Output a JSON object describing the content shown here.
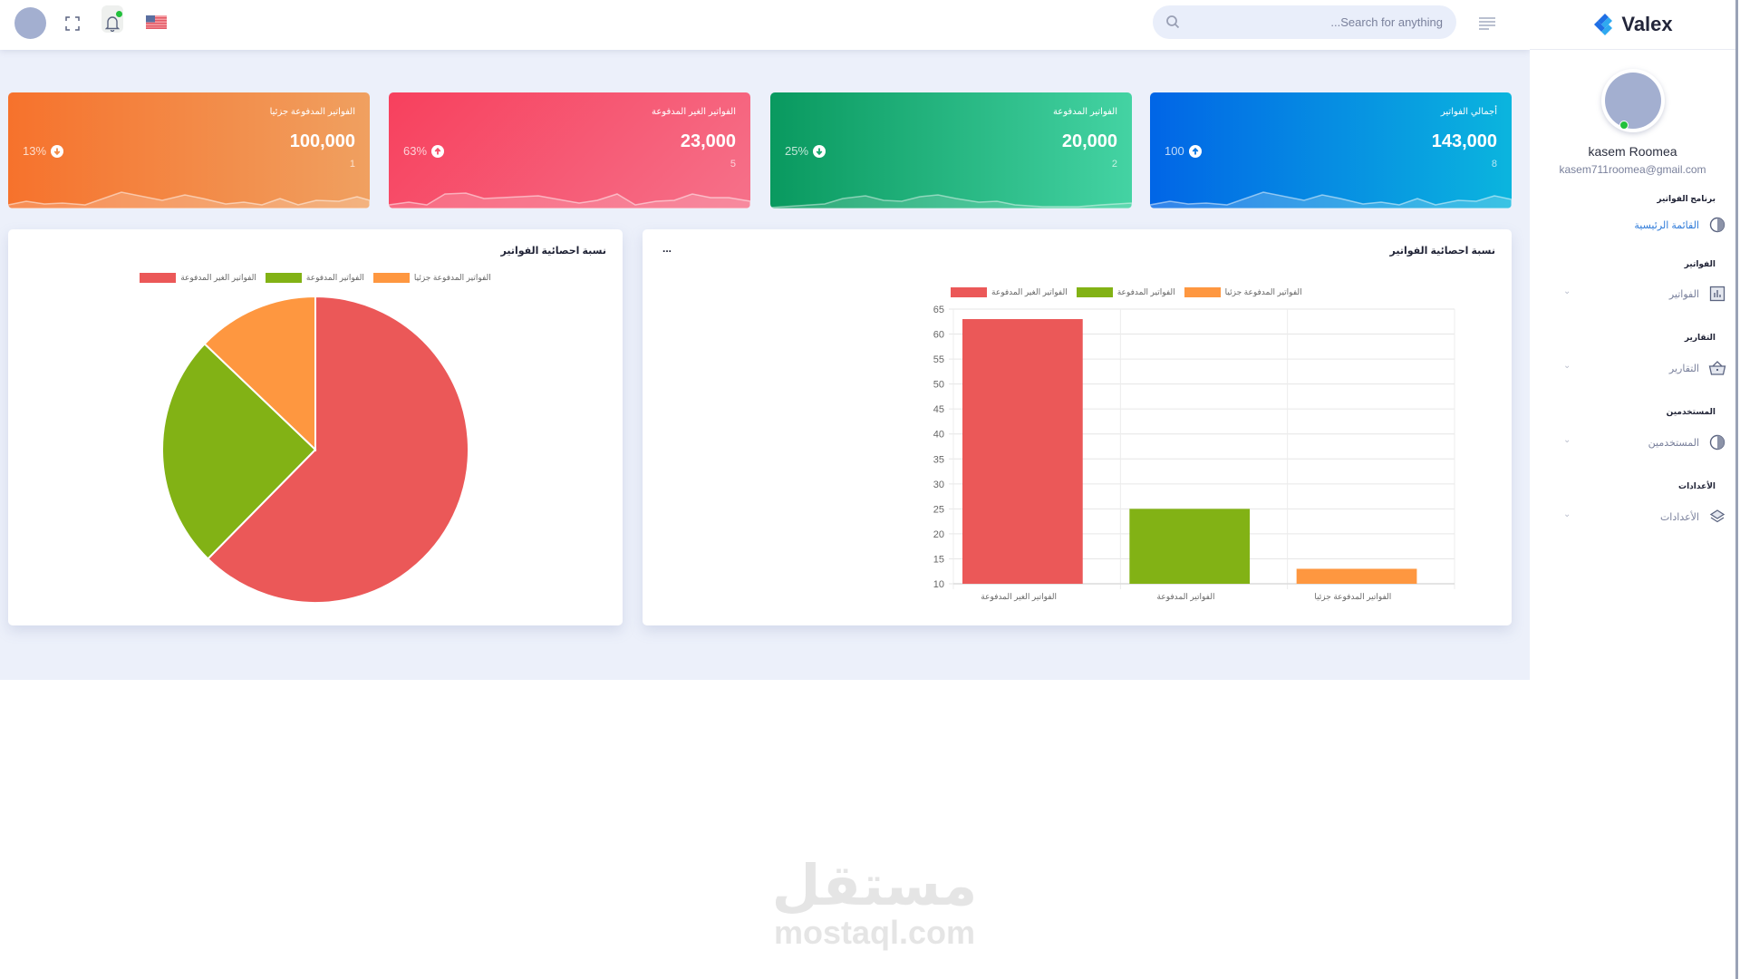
{
  "header": {
    "search_placeholder": "...Search for anything",
    "icons": [
      "avatar",
      "fullscreen-icon",
      "bell-icon",
      "us-flag-icon",
      "search-icon",
      "menu-icon"
    ]
  },
  "sidebar": {
    "brand": "Valex",
    "user_name": "kasem Roomea",
    "user_email": "kasem711roomea@gmail.com",
    "sections": [
      {
        "title": "برنامج الفواتير",
        "item": {
          "label": "القائمة الرئيسية",
          "icon": "pie-chart-icon",
          "active": true,
          "has_chevron": false
        }
      },
      {
        "title": "الفواتير",
        "item": {
          "label": "الفواتير",
          "icon": "bar-chart-icon",
          "active": false,
          "has_chevron": true
        }
      },
      {
        "title": "التقارير",
        "item": {
          "label": "التقارير",
          "icon": "basket-icon",
          "active": false,
          "has_chevron": true
        }
      },
      {
        "title": "المستخدمين",
        "item": {
          "label": "المستخدمين",
          "icon": "pie-chart-icon",
          "active": false,
          "has_chevron": true
        }
      },
      {
        "title": "الأعدادات",
        "item": {
          "label": "الأعدادات",
          "icon": "layers-icon",
          "active": false,
          "has_chevron": true
        }
      }
    ]
  },
  "stats": [
    {
      "title": "الفواتير المدفوعة جزئيا",
      "value": "100,000",
      "count": "1",
      "change": "13%",
      "direction": "down",
      "color": "#f6722c"
    },
    {
      "title": "الفواتير الغير المدفوعة",
      "value": "23,000",
      "count": "5",
      "change": "63%",
      "direction": "up",
      "color": "#f7405d"
    },
    {
      "title": "الفواتير المدفوعة",
      "value": "20,000",
      "count": "2",
      "change": "25%",
      "direction": "down",
      "color": "#09995f"
    },
    {
      "title": "أجمالي الفواتير",
      "value": "143,000",
      "count": "8",
      "change": "100",
      "direction": "up",
      "color": "#0165e6"
    }
  ],
  "colors": {
    "unpaid": "#eb5858",
    "paid": "#82b215",
    "partial": "#fe9740"
  },
  "pie_card": {
    "title": "نسبة احصائية الفواتير"
  },
  "bar_card": {
    "title": "نسبة احصائية الفواتير",
    "more": "..."
  },
  "chart_data": [
    {
      "type": "pie",
      "title": "نسبة احصائية الفواتير",
      "legend_position": "top",
      "categories": [
        "الفواتير الغير المدفوعة",
        "الفواتير المدفوعة",
        "الفواتير المدفوعة جزئيا"
      ],
      "values": [
        63,
        25,
        13
      ],
      "colors": [
        "#eb5858",
        "#82b215",
        "#fe9740"
      ]
    },
    {
      "type": "bar",
      "title": "نسبة احصائية الفواتير",
      "legend_position": "top",
      "categories": [
        "الفواتير الغير المدفوعة",
        "الفواتير المدفوعة",
        "الفواتير المدفوعة جزئيا"
      ],
      "values": [
        63,
        25,
        13
      ],
      "colors": [
        "#eb5858",
        "#82b215",
        "#fe9740"
      ],
      "xlabel": "",
      "ylabel": "",
      "ylim": [
        10,
        65
      ],
      "yticks": [
        10,
        15,
        20,
        25,
        30,
        35,
        40,
        45,
        50,
        55,
        60,
        65
      ],
      "grid": true
    }
  ],
  "watermark": {
    "arabic": "مستقل",
    "latin": "mostaql.com"
  }
}
